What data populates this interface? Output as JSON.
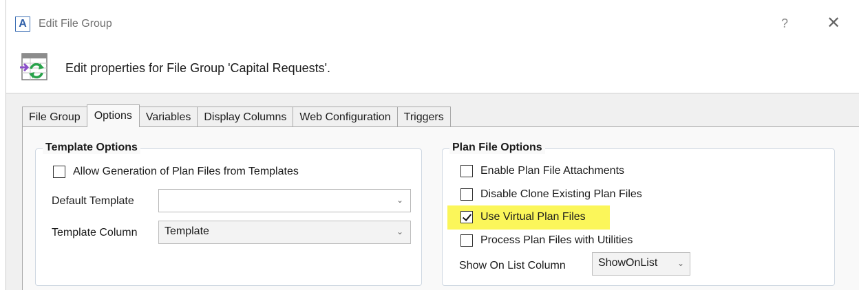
{
  "window": {
    "title": "Edit File Group",
    "app_icon_letter": "A",
    "help_label": "?",
    "close_label": "✕"
  },
  "header": {
    "text": "Edit properties for File Group 'Capital Requests'."
  },
  "tabs": [
    {
      "label": "File Group",
      "active": false
    },
    {
      "label": "Options",
      "active": true
    },
    {
      "label": "Variables",
      "active": false
    },
    {
      "label": "Display Columns",
      "active": false
    },
    {
      "label": "Web Configuration",
      "active": false
    },
    {
      "label": "Triggers",
      "active": false
    }
  ],
  "template_options": {
    "title": "Template Options",
    "allow_generation": {
      "label": "Allow Generation of Plan Files from Templates",
      "checked": false
    },
    "default_template": {
      "label": "Default Template",
      "value": ""
    },
    "template_column": {
      "label": "Template Column",
      "value": "Template"
    }
  },
  "plan_file_options": {
    "title": "Plan File Options",
    "checkboxes": [
      {
        "label": "Enable Plan File Attachments",
        "checked": false
      },
      {
        "label": "Disable Clone Existing Plan Files",
        "checked": false
      },
      {
        "label": "Use Virtual Plan Files",
        "checked": true
      },
      {
        "label": "Process Plan Files with Utilities",
        "checked": false
      }
    ],
    "show_on_list": {
      "label": "Show On List Column",
      "value": "ShowOnList"
    }
  },
  "colors": {
    "highlight": "#fbf65a",
    "accent": "#2f5fa8"
  }
}
